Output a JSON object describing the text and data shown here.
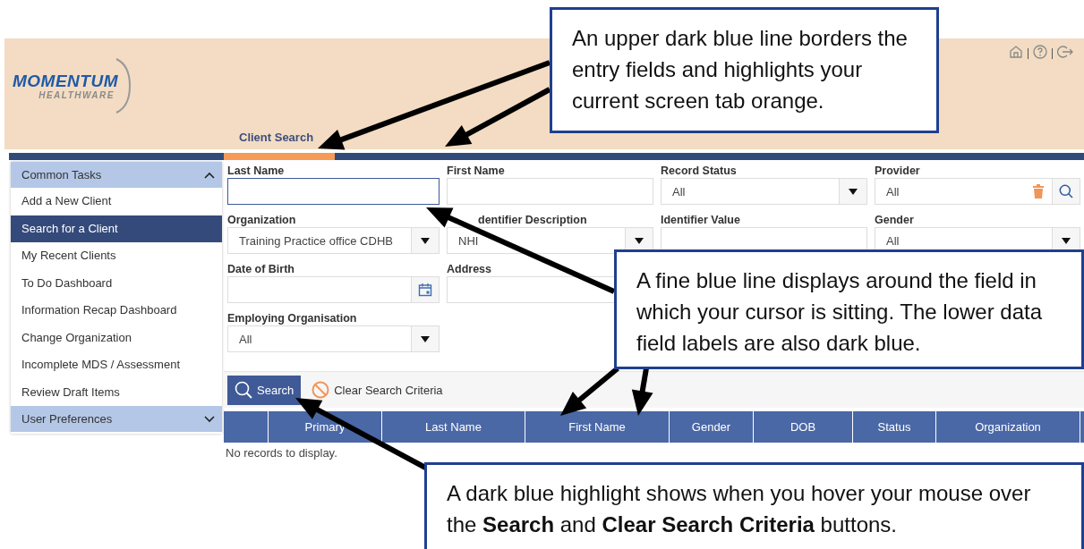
{
  "header": {
    "logo": {
      "name": "MOMENTUM",
      "sub": "HEALTHWARE"
    },
    "tabs": [
      {
        "label": "Client Search",
        "selected": true
      }
    ]
  },
  "sidebar": {
    "sections": [
      {
        "title": "Common Tasks",
        "expanded": true,
        "items": [
          {
            "label": "Add a New Client",
            "selected": false
          },
          {
            "label": "Search for a Client",
            "selected": true
          },
          {
            "label": "My Recent Clients",
            "selected": false
          },
          {
            "label": "To Do Dashboard",
            "selected": false
          },
          {
            "label": "Information Recap Dashboard",
            "selected": false
          },
          {
            "label": "Change Organization",
            "selected": false
          },
          {
            "label": "Incomplete MDS / Assessment",
            "selected": false
          },
          {
            "label": "Review Draft Items",
            "selected": false
          }
        ]
      },
      {
        "title": "User Preferences",
        "expanded": false
      }
    ]
  },
  "form": {
    "rows": [
      [
        {
          "label": "Last Name",
          "kind": "text",
          "focused": true
        },
        {
          "label": "First Name",
          "kind": "text",
          "focused": false
        },
        {
          "label": "Record Status",
          "kind": "select",
          "value": "All",
          "focused": false
        },
        {
          "label": "Provider",
          "kind": "lookup",
          "value": "All",
          "focused": false
        }
      ],
      [
        {
          "label": "Organization",
          "kind": "select",
          "value": "Training Practice office CDHB",
          "focused": false
        },
        {
          "label": "dentifier Description",
          "kind": "select",
          "value": "NHI",
          "focused": false
        },
        {
          "label": "Identifier Value",
          "kind": "text",
          "focused": false
        },
        {
          "label": "Gender",
          "kind": "select",
          "value": "All",
          "focused": false
        }
      ],
      [
        {
          "label": "Date of Birth",
          "kind": "date",
          "focused": false
        },
        {
          "label": "Address",
          "kind": "text",
          "focused": false
        }
      ],
      [
        {
          "label": "Employing Organisation",
          "kind": "select",
          "value": "All",
          "focused": false
        }
      ]
    ]
  },
  "toolbar": {
    "buttons": [
      {
        "label": "Search",
        "kind": "search",
        "hovered": true
      },
      {
        "label": "Clear Search Criteria",
        "kind": "clear",
        "hovered": false
      }
    ]
  },
  "table": {
    "columns": [
      "Primary",
      "Last Name",
      "First Name",
      "Gender",
      "DOB",
      "Status",
      "Organization"
    ],
    "empty_message": "No records to display."
  },
  "callouts": [
    {
      "text": "An upper dark blue line borders the entry fields and highlights your current screen tab orange."
    },
    {
      "text": "A fine blue line displays around the field in which your cursor is sitting. The lower data field labels are also dark blue."
    },
    {
      "text": "A dark blue highlight shows when you hover your mouse over the **Search** and **Clear Search Criteria** buttons."
    }
  ]
}
